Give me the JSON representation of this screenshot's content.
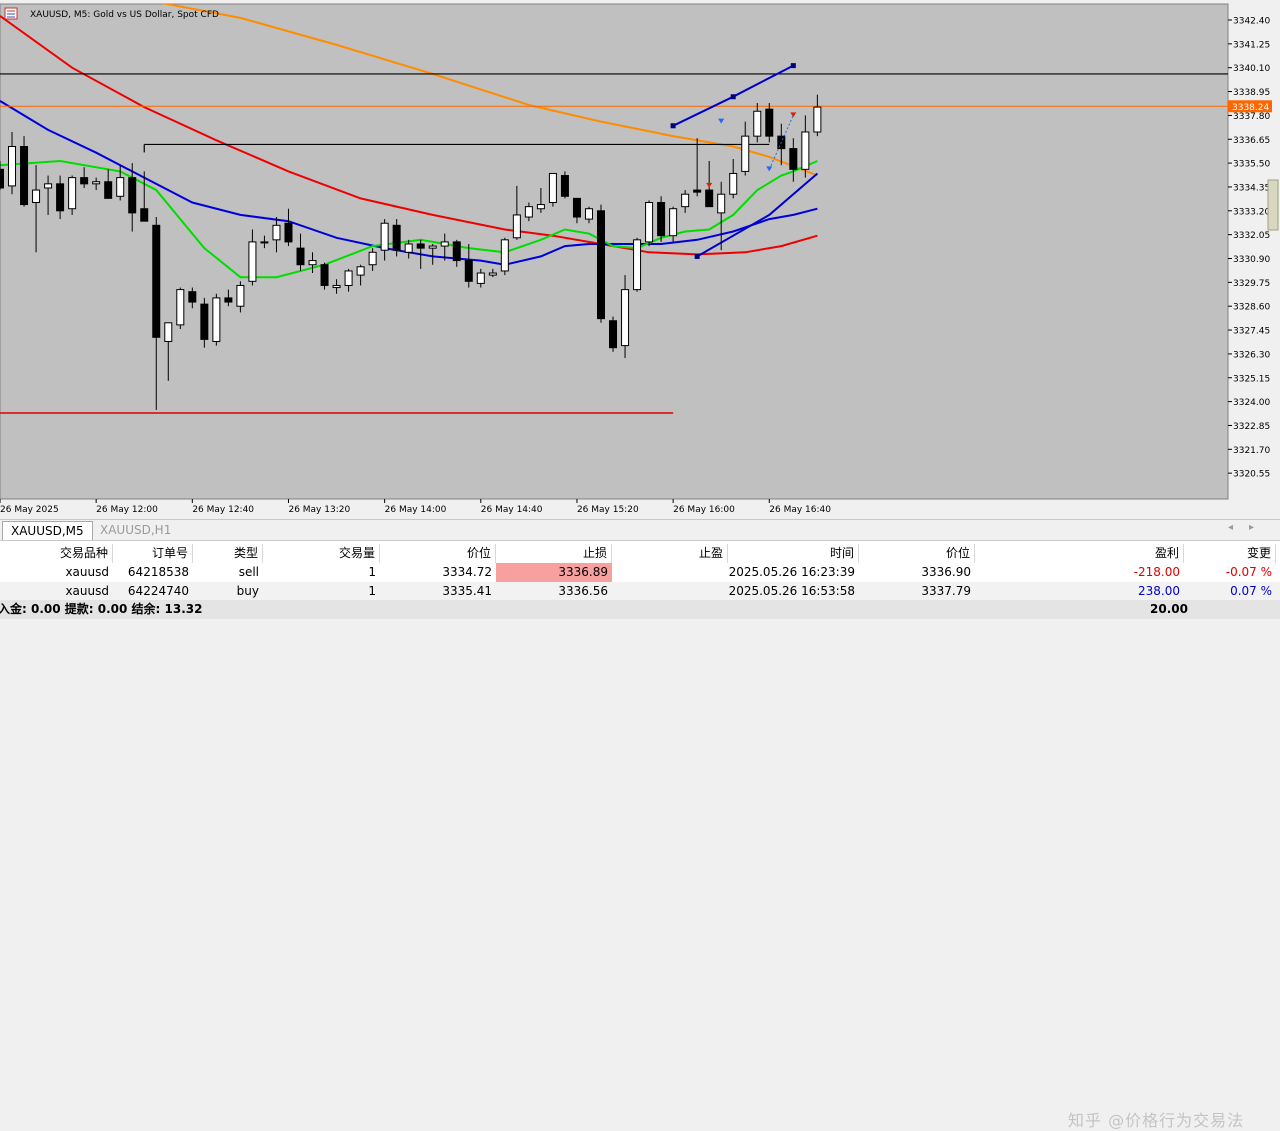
{
  "chart": {
    "title": "XAUUSD, M5:  Gold vs US Dollar, Spot CFD",
    "icon": "chart-window-icon",
    "y_ticks": [
      "3342.40",
      "3341.25",
      "3340.10",
      "3338.95",
      "3337.80",
      "3336.65",
      "3335.50",
      "3334.35",
      "3333.20",
      "3332.05",
      "3330.90",
      "3329.75",
      "3328.60",
      "3327.45",
      "3326.30",
      "3325.15",
      "3324.00",
      "3322.85",
      "3321.70",
      "3320.55"
    ],
    "x_ticks": [
      "26 May 2025",
      "26 May 12:00",
      "26 May 12:40",
      "26 May 13:20",
      "26 May 14:00",
      "26 May 14:40",
      "26 May 15:20",
      "26 May 16:00",
      "26 May 16:40"
    ],
    "current_price_label": "3338.24",
    "colors": {
      "bull": "#ffffff",
      "bear": "#000000",
      "ma_green": "#00dd00",
      "ma_blue": "#0000dd",
      "ma_red": "#ee0000",
      "ma_orange": "#ff8c00",
      "price_line": "#ff6600",
      "background": "#c0c0c0"
    }
  },
  "chart_data": {
    "type": "candlestick",
    "symbol": "XAUUSD",
    "timeframe": "M5",
    "ylim": [
      3319.6,
      3343.5
    ],
    "candles": [
      {
        "o": 3335.2,
        "h": 3335.6,
        "l": 3334.2,
        "c": 3334.3
      },
      {
        "o": 3334.4,
        "h": 3337.0,
        "l": 3334.0,
        "c": 3336.3
      },
      {
        "o": 3336.3,
        "h": 3336.8,
        "l": 3333.4,
        "c": 3333.5
      },
      {
        "o": 3333.6,
        "h": 3335.4,
        "l": 3331.2,
        "c": 3334.2
      },
      {
        "o": 3334.3,
        "h": 3334.9,
        "l": 3333.0,
        "c": 3334.5
      },
      {
        "o": 3334.5,
        "h": 3334.9,
        "l": 3332.8,
        "c": 3333.2
      },
      {
        "o": 3333.3,
        "h": 3334.9,
        "l": 3333.0,
        "c": 3334.8
      },
      {
        "o": 3334.8,
        "h": 3335.3,
        "l": 3334.3,
        "c": 3334.5
      },
      {
        "o": 3334.5,
        "h": 3334.8,
        "l": 3334.2,
        "c": 3334.6
      },
      {
        "o": 3334.6,
        "h": 3335.2,
        "l": 3333.8,
        "c": 3333.8
      },
      {
        "o": 3333.9,
        "h": 3335.4,
        "l": 3333.7,
        "c": 3334.8
      },
      {
        "o": 3334.8,
        "h": 3335.5,
        "l": 3332.2,
        "c": 3333.1
      },
      {
        "o": 3333.3,
        "h": 3335.1,
        "l": 3332.7,
        "c": 3332.7
      },
      {
        "o": 3332.5,
        "h": 3332.9,
        "l": 3323.6,
        "c": 3327.1
      },
      {
        "o": 3326.9,
        "h": 3327.5,
        "l": 3325.0,
        "c": 3327.8
      },
      {
        "o": 3327.7,
        "h": 3329.5,
        "l": 3327.5,
        "c": 3329.4
      },
      {
        "o": 3329.3,
        "h": 3329.5,
        "l": 3328.5,
        "c": 3328.8
      },
      {
        "o": 3328.7,
        "h": 3329.0,
        "l": 3326.6,
        "c": 3327.0
      },
      {
        "o": 3326.9,
        "h": 3329.2,
        "l": 3326.7,
        "c": 3329.0
      },
      {
        "o": 3329.0,
        "h": 3329.4,
        "l": 3328.6,
        "c": 3328.8
      },
      {
        "o": 3328.6,
        "h": 3329.8,
        "l": 3328.3,
        "c": 3329.6
      },
      {
        "o": 3329.8,
        "h": 3332.3,
        "l": 3329.6,
        "c": 3331.7
      },
      {
        "o": 3331.7,
        "h": 3332.0,
        "l": 3331.4,
        "c": 3331.7
      },
      {
        "o": 3331.8,
        "h": 3332.9,
        "l": 3331.2,
        "c": 3332.5
      },
      {
        "o": 3332.6,
        "h": 3333.3,
        "l": 3331.5,
        "c": 3331.7
      },
      {
        "o": 3331.4,
        "h": 3332.1,
        "l": 3330.3,
        "c": 3330.6
      },
      {
        "o": 3330.6,
        "h": 3331.2,
        "l": 3330.2,
        "c": 3330.8
      },
      {
        "o": 3330.6,
        "h": 3330.7,
        "l": 3329.4,
        "c": 3329.6
      },
      {
        "o": 3329.5,
        "h": 3329.9,
        "l": 3329.2,
        "c": 3329.6
      },
      {
        "o": 3329.6,
        "h": 3330.4,
        "l": 3329.3,
        "c": 3330.3
      },
      {
        "o": 3330.1,
        "h": 3330.6,
        "l": 3329.6,
        "c": 3330.5
      },
      {
        "o": 3330.6,
        "h": 3331.4,
        "l": 3330.3,
        "c": 3331.2
      },
      {
        "o": 3331.3,
        "h": 3332.8,
        "l": 3330.8,
        "c": 3332.6
      },
      {
        "o": 3332.5,
        "h": 3332.8,
        "l": 3331.0,
        "c": 3331.3
      },
      {
        "o": 3331.2,
        "h": 3331.8,
        "l": 3330.9,
        "c": 3331.6
      },
      {
        "o": 3331.6,
        "h": 3331.8,
        "l": 3330.4,
        "c": 3331.4
      },
      {
        "o": 3331.4,
        "h": 3331.6,
        "l": 3330.6,
        "c": 3331.5
      },
      {
        "o": 3331.5,
        "h": 3332.1,
        "l": 3330.8,
        "c": 3331.7
      },
      {
        "o": 3331.7,
        "h": 3331.8,
        "l": 3330.5,
        "c": 3330.8
      },
      {
        "o": 3330.8,
        "h": 3331.6,
        "l": 3329.5,
        "c": 3329.8
      },
      {
        "o": 3329.7,
        "h": 3330.4,
        "l": 3329.5,
        "c": 3330.2
      },
      {
        "o": 3330.1,
        "h": 3330.4,
        "l": 3330.0,
        "c": 3330.2
      },
      {
        "o": 3330.3,
        "h": 3331.9,
        "l": 3330.1,
        "c": 3331.8
      },
      {
        "o": 3331.9,
        "h": 3334.4,
        "l": 3331.8,
        "c": 3333.0
      },
      {
        "o": 3332.9,
        "h": 3333.6,
        "l": 3332.7,
        "c": 3333.4
      },
      {
        "o": 3333.3,
        "h": 3334.3,
        "l": 3333.1,
        "c": 3333.5
      },
      {
        "o": 3333.6,
        "h": 3335.0,
        "l": 3333.4,
        "c": 3335.0
      },
      {
        "o": 3334.9,
        "h": 3335.1,
        "l": 3333.8,
        "c": 3333.9
      },
      {
        "o": 3333.8,
        "h": 3333.8,
        "l": 3332.6,
        "c": 3332.9
      },
      {
        "o": 3332.8,
        "h": 3333.4,
        "l": 3332.6,
        "c": 3333.3
      },
      {
        "o": 3333.2,
        "h": 3333.5,
        "l": 3327.8,
        "c": 3328.0
      },
      {
        "o": 3327.9,
        "h": 3328.1,
        "l": 3326.4,
        "c": 3326.6
      },
      {
        "o": 3326.7,
        "h": 3330.1,
        "l": 3326.1,
        "c": 3329.4
      },
      {
        "o": 3329.4,
        "h": 3331.9,
        "l": 3329.3,
        "c": 3331.8
      },
      {
        "o": 3331.7,
        "h": 3333.7,
        "l": 3331.5,
        "c": 3333.6
      },
      {
        "o": 3333.6,
        "h": 3333.9,
        "l": 3331.7,
        "c": 3332.0
      },
      {
        "o": 3332.0,
        "h": 3333.4,
        "l": 3331.7,
        "c": 3333.3
      },
      {
        "o": 3333.4,
        "h": 3334.2,
        "l": 3333.1,
        "c": 3334.0
      },
      {
        "o": 3334.2,
        "h": 3336.7,
        "l": 3333.9,
        "c": 3334.1
      },
      {
        "o": 3334.2,
        "h": 3335.6,
        "l": 3333.8,
        "c": 3333.4
      },
      {
        "o": 3333.1,
        "h": 3334.6,
        "l": 3331.3,
        "c": 3334.0
      },
      {
        "o": 3334.0,
        "h": 3335.7,
        "l": 3333.8,
        "c": 3335.0
      },
      {
        "o": 3335.1,
        "h": 3337.5,
        "l": 3334.9,
        "c": 3336.8
      },
      {
        "o": 3336.8,
        "h": 3338.4,
        "l": 3336.5,
        "c": 3338.0
      },
      {
        "o": 3338.1,
        "h": 3338.4,
        "l": 3336.5,
        "c": 3336.8
      },
      {
        "o": 3336.8,
        "h": 3337.4,
        "l": 3335.4,
        "c": 3336.2
      },
      {
        "o": 3336.2,
        "h": 3336.7,
        "l": 3334.6,
        "c": 3335.2
      },
      {
        "o": 3335.2,
        "h": 3337.8,
        "l": 3334.8,
        "c": 3337.0
      },
      {
        "o": 3337.0,
        "h": 3338.8,
        "l": 3336.8,
        "c": 3338.2
      }
    ],
    "moving_averages": [
      {
        "color": "#00dd00",
        "values": [
          [
            0,
            3335.4
          ],
          [
            5,
            3335.6
          ],
          [
            10,
            3335.1
          ],
          [
            13,
            3334.2
          ],
          [
            17,
            3331.4
          ],
          [
            20,
            3330.0
          ],
          [
            23,
            3330.0
          ],
          [
            27,
            3330.6
          ],
          [
            31,
            3331.5
          ],
          [
            35,
            3331.8
          ],
          [
            39,
            3331.4
          ],
          [
            42,
            3331.2
          ],
          [
            45,
            3331.8
          ],
          [
            47,
            3332.3
          ],
          [
            49,
            3332.1
          ],
          [
            51,
            3331.5
          ],
          [
            53,
            3331.4
          ],
          [
            55,
            3331.9
          ],
          [
            57,
            3332.2
          ],
          [
            59,
            3332.3
          ],
          [
            61,
            3333.0
          ],
          [
            63,
            3334.2
          ],
          [
            65,
            3334.9
          ],
          [
            66,
            3335.1
          ],
          [
            68,
            3335.6
          ]
        ]
      },
      {
        "color": "#0000dd",
        "values": [
          [
            0,
            3338.5
          ],
          [
            4,
            3337.1
          ],
          [
            8,
            3336.0
          ],
          [
            12,
            3334.8
          ],
          [
            16,
            3333.6
          ],
          [
            20,
            3333.0
          ],
          [
            24,
            3332.7
          ],
          [
            28,
            3331.9
          ],
          [
            32,
            3331.4
          ],
          [
            36,
            3331.0
          ],
          [
            40,
            3330.8
          ],
          [
            42,
            3330.6
          ],
          [
            45,
            3331.0
          ],
          [
            47,
            3331.5
          ],
          [
            49,
            3331.6
          ],
          [
            55,
            3331.6
          ],
          [
            58,
            3331.8
          ],
          [
            61,
            3332.2
          ],
          [
            64,
            3332.8
          ],
          [
            66,
            3333.0
          ],
          [
            68,
            3333.3
          ]
        ]
      },
      {
        "color": "#ee0000",
        "values": [
          [
            0,
            3342.6
          ],
          [
            6,
            3340.1
          ],
          [
            12,
            3338.2
          ],
          [
            18,
            3336.6
          ],
          [
            24,
            3335.1
          ],
          [
            30,
            3333.8
          ],
          [
            36,
            3333.0
          ],
          [
            42,
            3332.3
          ],
          [
            46,
            3332.0
          ],
          [
            50,
            3331.6
          ],
          [
            54,
            3331.2
          ],
          [
            58,
            3331.1
          ],
          [
            62,
            3331.2
          ],
          [
            65,
            3331.5
          ],
          [
            68,
            3332.0
          ]
        ]
      },
      {
        "color": "#ff8c00",
        "values": [
          [
            0,
            3344.5
          ],
          [
            10,
            3343.6
          ],
          [
            20,
            3342.5
          ],
          [
            28,
            3341.2
          ],
          [
            36,
            3339.8
          ],
          [
            44,
            3338.3
          ],
          [
            50,
            3337.5
          ],
          [
            56,
            3336.8
          ],
          [
            61,
            3336.3
          ],
          [
            64,
            3335.8
          ],
          [
            68,
            3334.9
          ]
        ]
      }
    ],
    "horizontal_lines": [
      {
        "price": 3339.8,
        "color": "#000000"
      },
      {
        "price": 3336.4,
        "color": "#000000"
      },
      {
        "price": 3323.45,
        "color": "#dd0000"
      }
    ],
    "current_price": 3338.24
  },
  "tabs": [
    "XAUUSD,M5",
    "XAUUSD,H1"
  ],
  "table": {
    "headers": [
      "交易品种",
      "订单号",
      "类型",
      "交易量",
      "价位",
      "止损",
      "止盈",
      "时间",
      "价位",
      "盈利",
      "变更"
    ],
    "rows": [
      [
        "xauusd",
        "64218538",
        "sell",
        "1",
        "3334.72",
        "3336.89",
        "",
        "2025.05.26 16:23:39",
        "3336.90",
        "-218.00",
        "-0.07 %"
      ],
      [
        "xauusd",
        "64224740",
        "buy",
        "1",
        "3335.41",
        "3336.56",
        "",
        "2025.05.26 16:53:58",
        "3337.79",
        "238.00",
        "0.07 %"
      ]
    ],
    "footer": "入金: 0.00  提款: 0.00  结余: 13.32",
    "total": "20.00"
  },
  "watermark": "知乎 @价格行为交易法"
}
